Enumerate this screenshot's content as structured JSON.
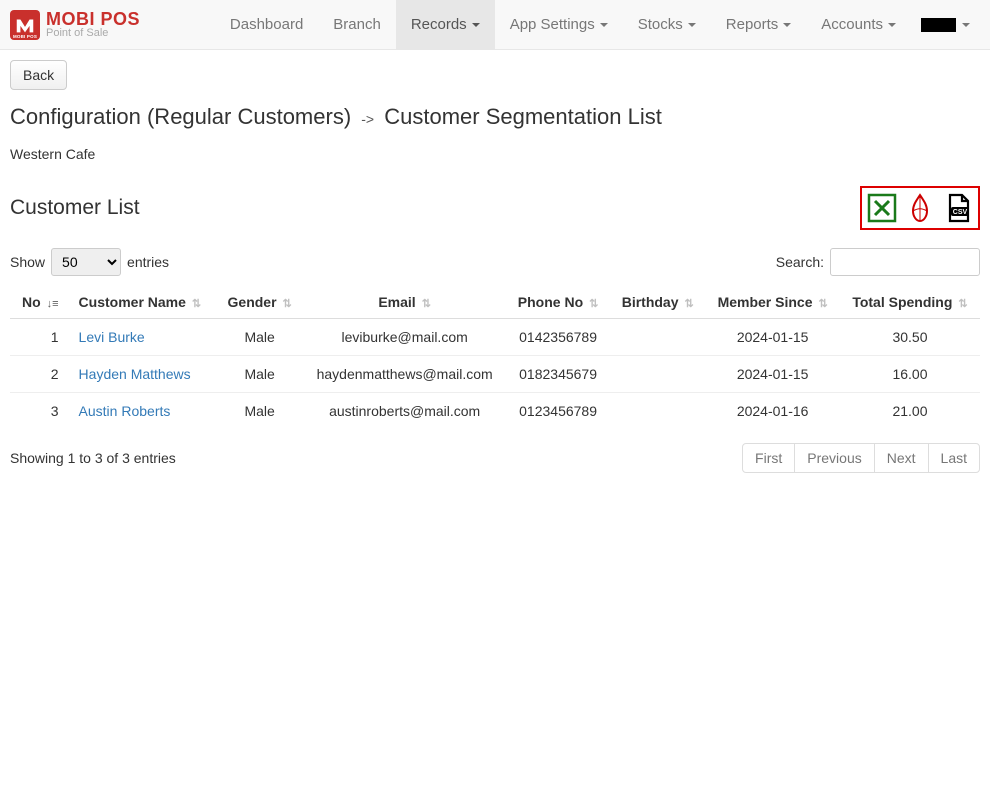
{
  "brand": {
    "line1": "MOBI POS",
    "line2": "Point of Sale"
  },
  "nav": {
    "dashboard": "Dashboard",
    "branch": "Branch",
    "records": "Records",
    "app_settings": "App Settings",
    "stocks": "Stocks",
    "reports": "Reports",
    "accounts": "Accounts"
  },
  "back_label": "Back",
  "breadcrumb": {
    "parent": "Configuration (Regular Customers)",
    "current": "Customer Segmentation List"
  },
  "store_name": "Western Cafe",
  "list_title": "Customer List",
  "table_controls": {
    "show_label": "Show",
    "entries_label": "entries",
    "entries_value": "50",
    "search_label": "Search:"
  },
  "columns": {
    "no": "No",
    "customer_name": "Customer Name",
    "gender": "Gender",
    "email": "Email",
    "phone_no": "Phone No",
    "birthday": "Birthday",
    "member_since": "Member Since",
    "total_spending": "Total Spending"
  },
  "rows": [
    {
      "no": "1",
      "name": "Levi Burke",
      "gender": "Male",
      "email": "leviburke@mail.com",
      "phone": "0142356789",
      "birthday": "",
      "member_since": "2024-01-15",
      "total_spending": "30.50"
    },
    {
      "no": "2",
      "name": "Hayden Matthews",
      "gender": "Male",
      "email": "haydenmatthews@mail.com",
      "phone": "0182345679",
      "birthday": "",
      "member_since": "2024-01-15",
      "total_spending": "16.00"
    },
    {
      "no": "3",
      "name": "Austin Roberts",
      "gender": "Male",
      "email": "austinroberts@mail.com",
      "phone": "0123456789",
      "birthday": "",
      "member_since": "2024-01-16",
      "total_spending": "21.00"
    }
  ],
  "footer_info": "Showing 1 to 3 of 3 entries",
  "pagination": {
    "first": "First",
    "previous": "Previous",
    "next": "Next",
    "last": "Last"
  }
}
